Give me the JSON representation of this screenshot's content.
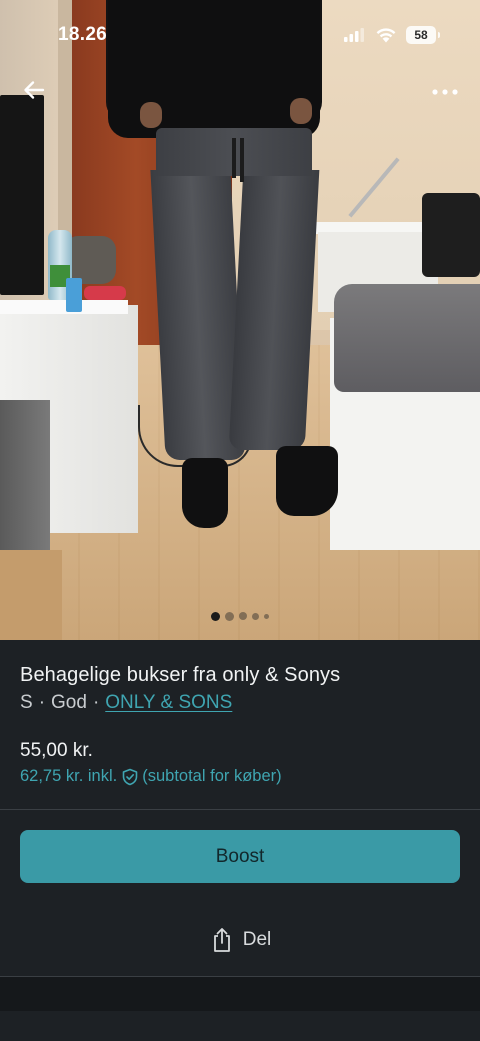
{
  "status_bar": {
    "time": "18.26",
    "battery": "58"
  },
  "photo": {
    "image_count": 5,
    "active_index": 0
  },
  "listing": {
    "title": "Behagelige bukser fra only & Sonys",
    "size": "S",
    "condition": "God",
    "separator": "·",
    "brand": "ONLY & SONS",
    "price": "55,00 kr.",
    "price_incl": "62,75 kr. inkl.",
    "subtotal_note": "(subtotal for køber)"
  },
  "actions": {
    "boost_label": "Boost",
    "share_label": "Del"
  },
  "colors": {
    "background": "#1d2125",
    "accent": "#3a9aa6",
    "link": "#3fa5b1"
  },
  "icons": {
    "back": "arrow-left-icon",
    "more": "more-dots-icon",
    "signal": "signal-icon",
    "wifi": "wifi-icon",
    "battery": "battery-icon",
    "shield": "shield-check-icon",
    "share": "share-icon"
  }
}
